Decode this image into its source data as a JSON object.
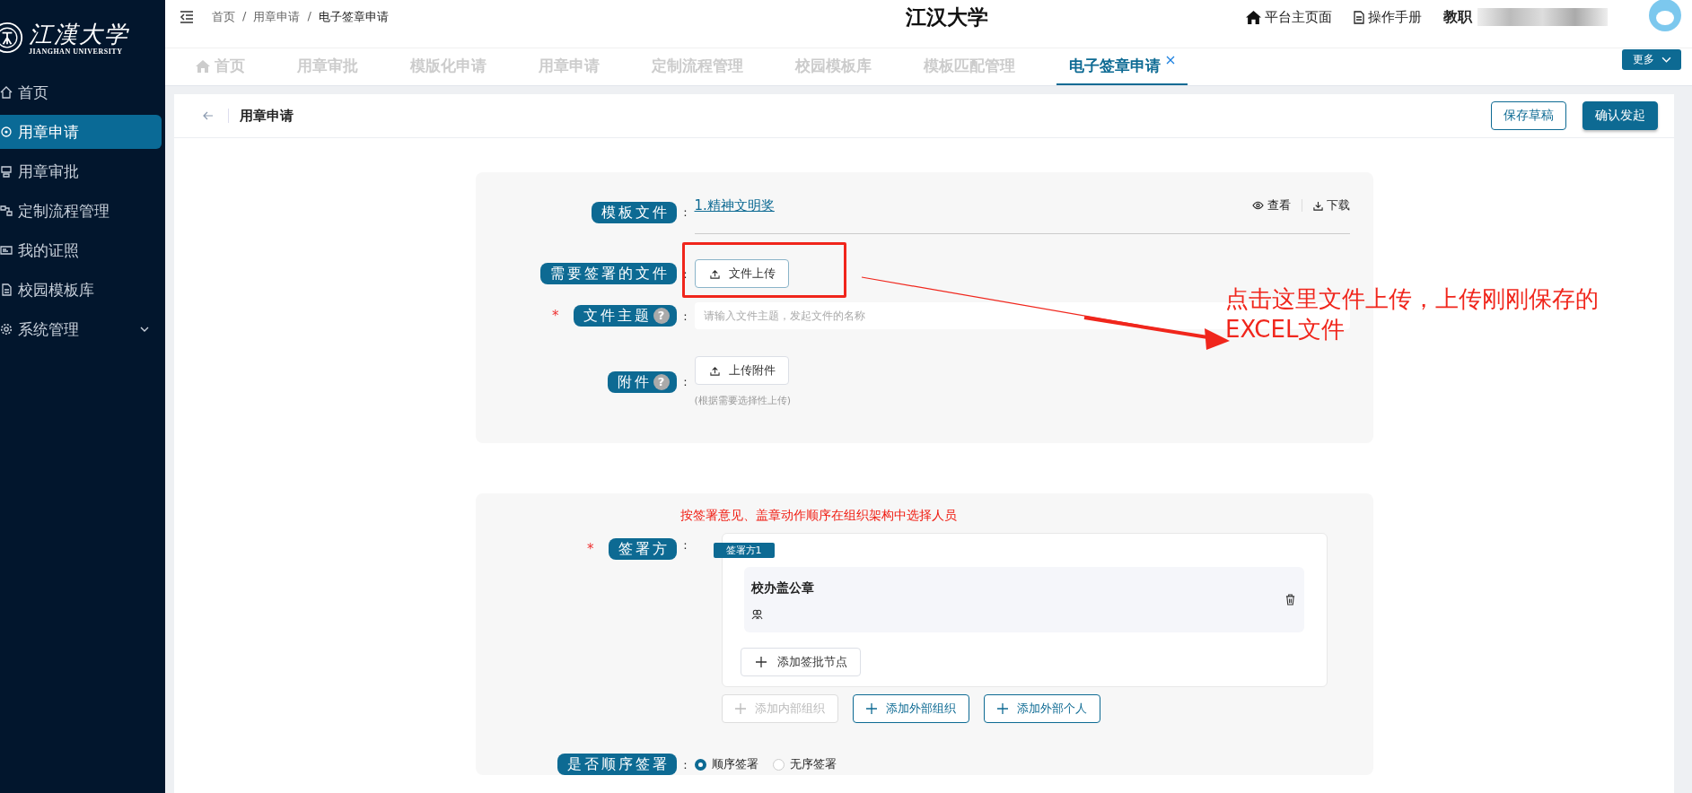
{
  "sidebar": {
    "logo": {
      "name": "江漢大学",
      "subtitle": "JIANGHAN UNIVERSITY"
    },
    "items": [
      {
        "label": "首页",
        "selected": false
      },
      {
        "label": "用章申请",
        "selected": true
      },
      {
        "label": "用章审批",
        "selected": false
      },
      {
        "label": "定制流程管理",
        "selected": false
      },
      {
        "label": "我的证照",
        "selected": false
      },
      {
        "label": "校园模板库",
        "selected": false
      },
      {
        "label": "系统管理",
        "selected": false,
        "expanded": false
      }
    ]
  },
  "header": {
    "breadcrumb": [
      "首页",
      "/",
      "用章申请",
      "/",
      "电子签章申请"
    ],
    "title": "江汉大学",
    "links": [
      "平台主页面",
      "操作手册"
    ],
    "user": "教职"
  },
  "tabs": [
    {
      "label": "首页",
      "selected": false
    },
    {
      "label": "用章审批",
      "selected": false
    },
    {
      "label": "模版化申请",
      "selected": false
    },
    {
      "label": "用章申请",
      "selected": false
    },
    {
      "label": "定制流程管理",
      "selected": false
    },
    {
      "label": "校园模板库",
      "selected": false
    },
    {
      "label": "模板匹配管理",
      "selected": false
    },
    {
      "label": "电子签章申请",
      "selected": true,
      "closable": true
    }
  ],
  "more_button": "更多",
  "page": {
    "title": "用章申请",
    "buttons": [
      {
        "label": "保存草稿",
        "kind": "outline"
      },
      {
        "label": "确认发起",
        "kind": "primary"
      }
    ]
  },
  "file_section": {
    "template": {
      "label": "模板文件",
      "colon": ":",
      "file": "1.精神文明奖",
      "actions": [
        "查看",
        "下载"
      ]
    },
    "sign_file": {
      "label": "需要签署的文件",
      "colon": ":",
      "button": "文件上传"
    },
    "subject": {
      "label": "文件主题",
      "required_mark": "*",
      "colon": ":",
      "help": "?",
      "placeholder": "请输入文件主题，发起文件的名称"
    },
    "attachment": {
      "label": "附件",
      "colon": ":",
      "help": "?",
      "button": "上传附件",
      "hint": "(根据需要选择性上传)"
    }
  },
  "signer_section": {
    "hint": "按签署意见、盖章动作顺序在组织架构中选择人员",
    "signers": {
      "label": "签署方",
      "required_mark": "*",
      "colon": ":",
      "groups": [
        {
          "tag": "签署方1",
          "nodes": [
            {
              "name": "校办盖公章"
            }
          ],
          "add_button": "添加签批节点"
        }
      ]
    },
    "add_buttons": [
      {
        "label": "添加内部组织",
        "disabled": true
      },
      {
        "label": "添加外部组织",
        "disabled": false
      },
      {
        "label": "添加外部个人",
        "disabled": false
      }
    ],
    "order": {
      "label": "是否顺序签署",
      "colon": ":",
      "options": [
        {
          "label": "顺序签署",
          "selected": true
        },
        {
          "label": "无序签署",
          "selected": false
        }
      ]
    }
  },
  "annotation": {
    "text": "点击这里文件上传，上传刚刚保存的EXCEL文件"
  }
}
